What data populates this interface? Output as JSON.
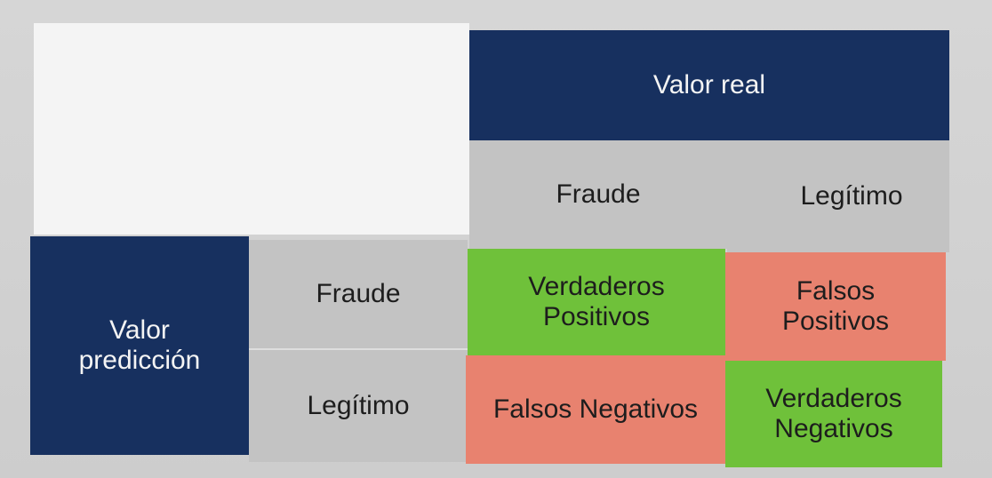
{
  "matrix": {
    "actual_header": "Valor real",
    "actual_classes": [
      "Fraude",
      "Legítimo"
    ],
    "predicted_header": {
      "line1": "Valor",
      "line2": "predicción"
    },
    "predicted_classes": [
      "Fraude",
      "Legítimo"
    ],
    "cells": {
      "tp": {
        "line1": "Verdaderos",
        "line2": "Positivos"
      },
      "fp": {
        "line1": "Falsos",
        "line2": "Positivos"
      },
      "fn": {
        "line1": "Falsos Negativos"
      },
      "tn": {
        "line1": "Verdaderos",
        "line2": "Negativos"
      }
    }
  },
  "colors": {
    "header_navy": "#17305f",
    "label_gray": "#c3c3c3",
    "correct_green": "#6fc13a",
    "error_red": "#e8826f"
  }
}
